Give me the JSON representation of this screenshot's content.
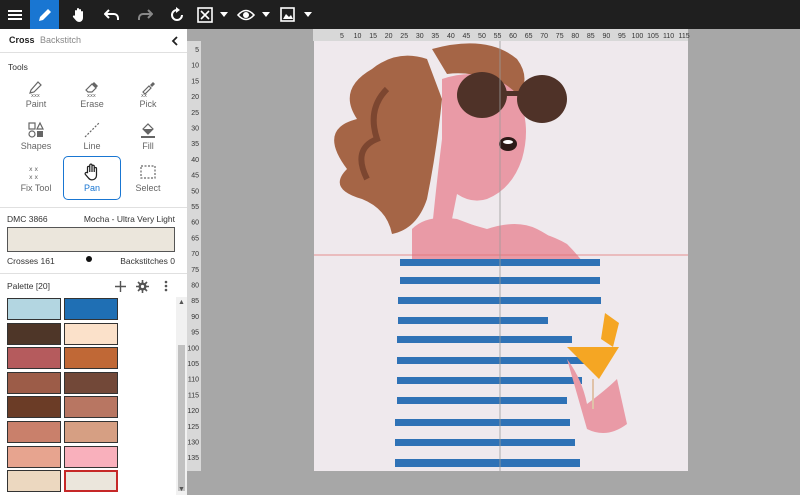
{
  "toolbar": {
    "buttons": [
      {
        "name": "menu-button",
        "icon": "hamburger-icon"
      },
      {
        "name": "draw-mode-button",
        "icon": "pencil-icon",
        "active": true
      },
      {
        "name": "pan-mode-button",
        "icon": "hand-icon"
      },
      {
        "name": "undo-button",
        "icon": "undo-icon"
      },
      {
        "name": "redo-button",
        "icon": "redo-icon"
      },
      {
        "name": "refresh-button",
        "icon": "refresh-icon"
      },
      {
        "name": "clear-button",
        "icon": "close-box-icon"
      },
      {
        "name": "view-button",
        "icon": "eye-icon"
      },
      {
        "name": "image-button",
        "icon": "image-icon"
      }
    ]
  },
  "panel": {
    "tabs": [
      "Cross",
      "Backstitch"
    ],
    "active_tab": "Cross",
    "tools_label": "Tools",
    "tools": [
      {
        "label": "Paint",
        "icon": "paint-icon"
      },
      {
        "label": "Erase",
        "icon": "eraser-icon"
      },
      {
        "label": "Pick",
        "icon": "eyedropper-icon"
      },
      {
        "label": "Shapes",
        "icon": "shapes-icon"
      },
      {
        "label": "Line",
        "icon": "line-icon"
      },
      {
        "label": "Fill",
        "icon": "fill-bucket-icon"
      },
      {
        "label": "Fix Tool",
        "icon": "fix-tool-icon"
      },
      {
        "label": "Pan",
        "icon": "hand-icon",
        "active": true
      },
      {
        "label": "Select",
        "icon": "select-icon"
      }
    ],
    "color": {
      "code": "DMC 3866",
      "name": "Mocha - Ultra Very Light",
      "swatch": "#ebe6dc",
      "crosses": "Crosses 161",
      "backstitches": "Backstitches 0"
    },
    "palette": {
      "label": "Palette [20]",
      "swatches": [
        "#b3d6e1",
        "#1f6fb4",
        "#4e3628",
        "#fbe1ca",
        "#b55b5d",
        "#c06836",
        "#9c5c48",
        "#724838",
        "#6b3c26",
        "#b87662",
        "#c9806b",
        "#d69f83",
        "#e7a48f",
        "#f9b0bc",
        "#ecd8c0",
        "#ebe6dc"
      ],
      "selected_index": 15
    }
  },
  "ruler": {
    "top": [
      "5",
      "10",
      "15",
      "20",
      "25",
      "30",
      "35",
      "40",
      "45",
      "50",
      "55",
      "60",
      "65",
      "70",
      "75",
      "80",
      "85",
      "90",
      "95",
      "100",
      "105",
      "110",
      "115"
    ],
    "left": [
      "5",
      "10",
      "15",
      "20",
      "25",
      "30",
      "35",
      "40",
      "45",
      "50",
      "55",
      "60",
      "65",
      "70",
      "75",
      "80",
      "85",
      "90",
      "95",
      "100",
      "105",
      "110",
      "115",
      "120",
      "125",
      "130",
      "135"
    ]
  },
  "colors": {
    "toolbar_bg": "#1f1f1f",
    "accent": "#1976d2",
    "canvas_bg": "#a7a7a7",
    "fabric": "#efe9ed",
    "stripe": "#2f72b6",
    "skin": "#e99aa6",
    "hair": "#a56546",
    "glasses": "#4f3228"
  }
}
